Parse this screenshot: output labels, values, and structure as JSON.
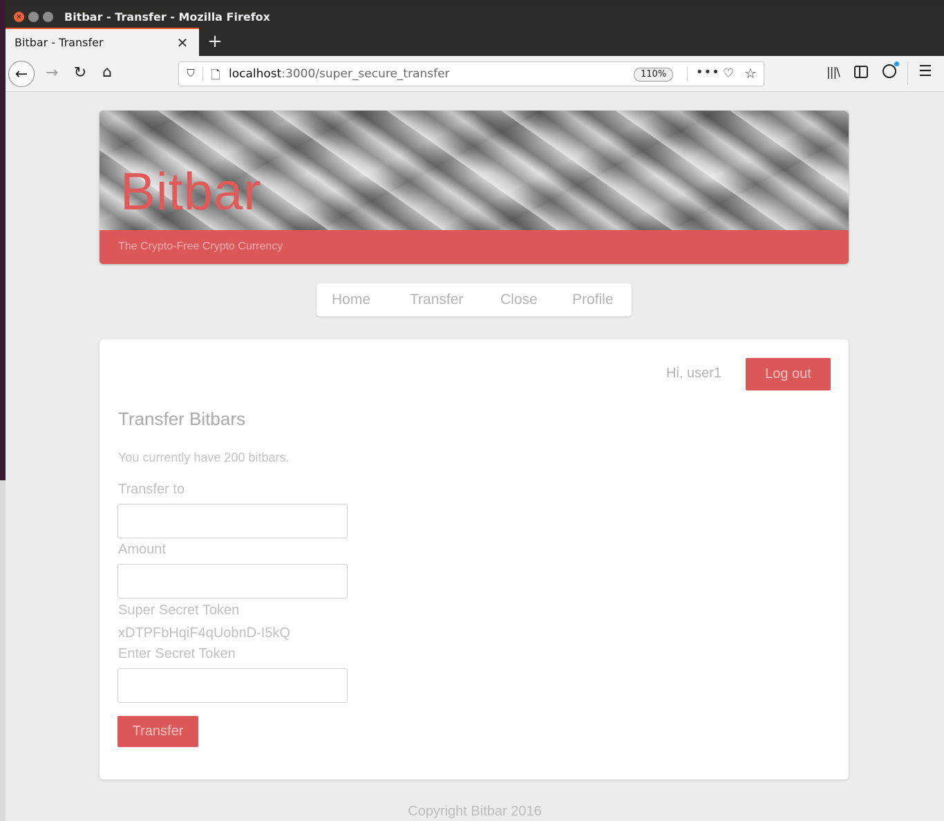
{
  "window": {
    "title": "Bitbar - Transfer - Mozilla Firefox"
  },
  "tabs": [
    {
      "label": "Bitbar - Transfer",
      "active": true
    }
  ],
  "toolbar": {
    "url_host": "localhost",
    "url_path": ":3000/super_secure_transfer",
    "zoom": "110%"
  },
  "icons": {
    "close": "✕",
    "new_tab": "+",
    "back": "←",
    "forward": "→",
    "reload": "↻",
    "home": "⌂",
    "shield": "⛉",
    "page": "🗋",
    "more": "•••",
    "pocket": "♡",
    "star": "☆",
    "library": "|||\\",
    "menu": "☰"
  },
  "banner": {
    "brand": "Bitbar",
    "tagline": "The Crypto-Free Crypto Currency"
  },
  "nav": {
    "items": [
      "Home",
      "Transfer",
      "Close",
      "Profile"
    ]
  },
  "card": {
    "greeting": "Hi, user1",
    "logout_label": "Log out",
    "title": "Transfer Bitbars",
    "balance_text": "You currently have 200 bitbars.",
    "transfer_to_label": "Transfer to",
    "transfer_to_value": "",
    "amount_label": "Amount",
    "amount_value": "",
    "token_label": "Super Secret Token",
    "token_value": "xDTPFbHqiF4qUobnD-I5kQ",
    "enter_token_label": "Enter Secret Token",
    "enter_token_value": "",
    "submit_label": "Transfer"
  },
  "footer": {
    "text": "Copyright Bitbar 2016"
  },
  "colors": {
    "accent": "#dc5858",
    "ubuntu_orange": "#e95420",
    "titlebar": "#2d2c29"
  }
}
